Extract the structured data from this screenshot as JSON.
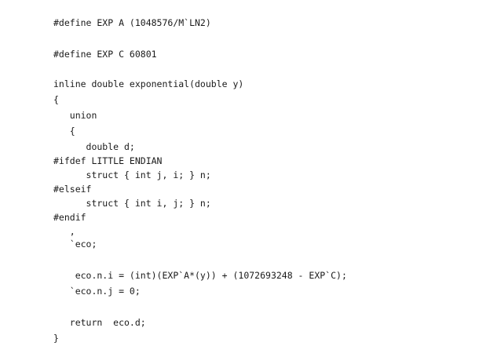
{
  "code": {
    "lines": [
      "#define EXP A (1048576/M`LN2)",
      "#define EXP C 60801",
      "inline double exponential(double y)",
      "{",
      "   union",
      "   {",
      "      double d;",
      "#ifdef LITTLE ENDIAN",
      "      struct { int j, i; } n;",
      "#elseif",
      "      struct { int i, j; } n;",
      "#endif",
      "   ,",
      "   `eco;",
      "    eco.n.i = (int)(EXP`A*(y)) + (1072693248 - EXP`C);",
      "   `eco.n.j = 0;",
      "   return  eco.d;",
      "}"
    ]
  }
}
